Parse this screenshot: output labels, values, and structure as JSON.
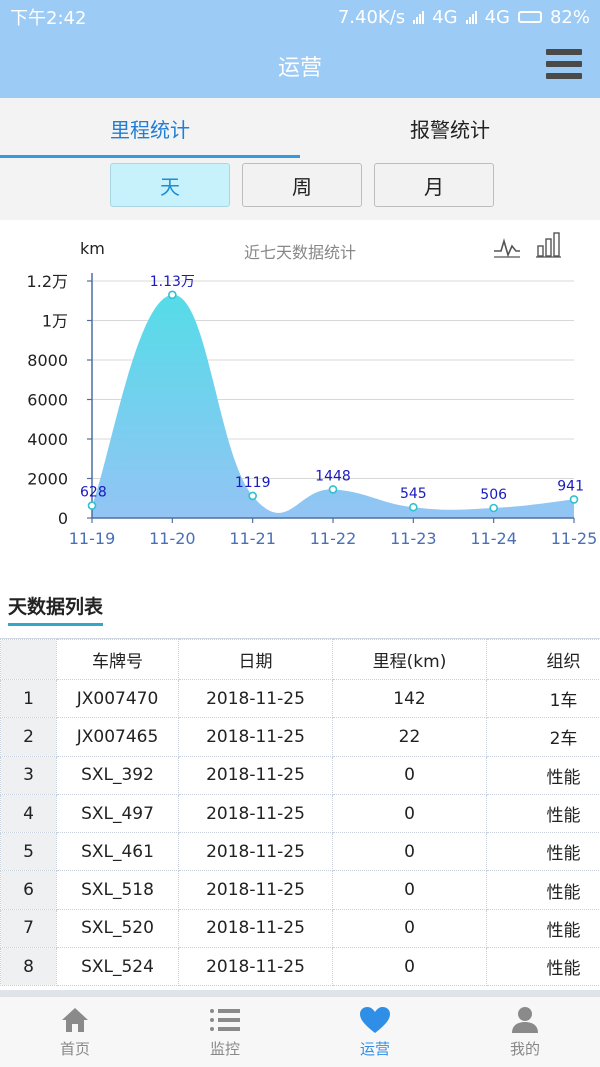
{
  "status": {
    "time": "下午2:42",
    "speed": "7.40K/s",
    "net1": "4G",
    "net2": "4G",
    "battery": "82%"
  },
  "header": {
    "title": "运营"
  },
  "tabs": [
    {
      "label": "里程统计",
      "active": true
    },
    {
      "label": "报警统计",
      "active": false
    }
  ],
  "period": [
    {
      "label": "天",
      "active": true
    },
    {
      "label": "周",
      "active": false
    },
    {
      "label": "月",
      "active": false
    }
  ],
  "chart_data": {
    "type": "area",
    "title": "近七天数据统计",
    "ylabel": "km",
    "x": [
      "11-19",
      "11-20",
      "11-21",
      "11-22",
      "11-23",
      "11-24",
      "11-25"
    ],
    "values": [
      628,
      11300,
      1119,
      1448,
      545,
      506,
      941
    ],
    "data_labels": [
      "628",
      "1.13万",
      "1119",
      "1448",
      "545",
      "506",
      "941"
    ],
    "yticks": [
      {
        "value": 0,
        "label": "0"
      },
      {
        "value": 2000,
        "label": "2000"
      },
      {
        "value": 4000,
        "label": "4000"
      },
      {
        "value": 6000,
        "label": "6000"
      },
      {
        "value": 8000,
        "label": "8000"
      },
      {
        "value": 10000,
        "label": "1万"
      },
      {
        "value": 12000,
        "label": "1.2万"
      }
    ],
    "ylim": [
      0,
      12000
    ],
    "grid": true,
    "colors": {
      "area_top": "#55dce8",
      "area_bottom": "#93c4f4",
      "label": "#1a1ac0",
      "axis": "#4f6f9f",
      "tick_x": "#4a6fb5"
    }
  },
  "list": {
    "title": "天数据列表",
    "columns": [
      "",
      "车牌号",
      "日期",
      "里程(km)",
      "组织"
    ],
    "rows": [
      [
        "1",
        "JX007470",
        "2018-11-25",
        "142",
        "1车"
      ],
      [
        "2",
        "JX007465",
        "2018-11-25",
        "22",
        "2车"
      ],
      [
        "3",
        "SXL_392",
        "2018-11-25",
        "0",
        "性能"
      ],
      [
        "4",
        "SXL_497",
        "2018-11-25",
        "0",
        "性能"
      ],
      [
        "5",
        "SXL_461",
        "2018-11-25",
        "0",
        "性能"
      ],
      [
        "6",
        "SXL_518",
        "2018-11-25",
        "0",
        "性能"
      ],
      [
        "7",
        "SXL_520",
        "2018-11-25",
        "0",
        "性能"
      ],
      [
        "8",
        "SXL_524",
        "2018-11-25",
        "0",
        "性能"
      ]
    ]
  },
  "bottom_nav": [
    {
      "label": "首页",
      "icon": "home-icon",
      "active": false
    },
    {
      "label": "监控",
      "icon": "list-icon",
      "active": false
    },
    {
      "label": "运营",
      "icon": "heart-icon",
      "active": true
    },
    {
      "label": "我的",
      "icon": "user-icon",
      "active": false
    }
  ]
}
